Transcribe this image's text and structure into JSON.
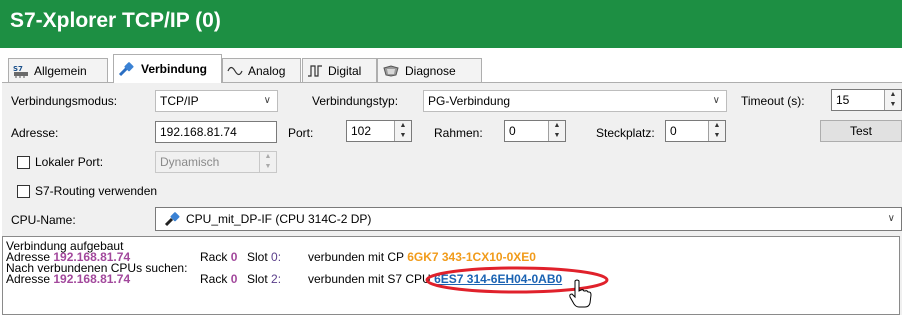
{
  "window": {
    "title": "S7-Xplorer TCP/IP (0)"
  },
  "tabs": [
    {
      "label": "Allgemein",
      "icon": "s7-chip-icon"
    },
    {
      "label": "Verbindung",
      "icon": "plug-icon",
      "active": true
    },
    {
      "label": "Analog",
      "icon": "sine-wave-icon"
    },
    {
      "label": "Digital",
      "icon": "square-wave-icon"
    },
    {
      "label": "Diagnose",
      "icon": "stethoscope-icon"
    }
  ],
  "connection": {
    "mode_label": "Verbindungsmodus:",
    "mode_value": "TCP/IP",
    "type_label": "Verbindungstyp:",
    "type_value": "PG-Verbindung",
    "timeout_label": "Timeout (s):",
    "timeout_value": "15",
    "address_label": "Adresse:",
    "address_value": "192.168.81.74",
    "port_label": "Port:",
    "port_value": "102",
    "rack_label": "Rahmen:",
    "rack_value": "0",
    "slot_label": "Steckplatz:",
    "slot_value": "0",
    "test_button": "Test",
    "local_port_label": "Lokaler Port:",
    "local_port_value": "Dynamisch",
    "routing_label": "S7-Routing verwenden",
    "cpu_label": "CPU-Name:",
    "cpu_value": "CPU_mit_DP-IF (CPU 314C-2 DP)"
  },
  "log": {
    "line1": "Verbindung aufgebaut",
    "line2": {
      "address_prefix": "Adresse",
      "address": "192.168.81.74",
      "rack_prefix": "Rack",
      "rack": "0",
      "slot_prefix": "Slot",
      "slot": "0:",
      "text": "verbunden mit CP",
      "part_number": "6GK7 343-1CX10-0XE0"
    },
    "line3": "Nach verbundenen CPUs suchen:",
    "line4": {
      "address_prefix": "Adresse",
      "address": "192.168.81.74",
      "rack_prefix": "Rack",
      "rack": "0",
      "slot_prefix": "Slot",
      "slot": "2:",
      "text": "verbunden mit S7 CPU",
      "part_number": "6ES7 314-6EH04-0AB0"
    }
  },
  "colors": {
    "title_bar": "#1d8f43",
    "address_purple": "#a2489c",
    "part_orange": "#f19b1a",
    "link_blue": "#1b63b3",
    "highlight_red": "#e0212b"
  }
}
